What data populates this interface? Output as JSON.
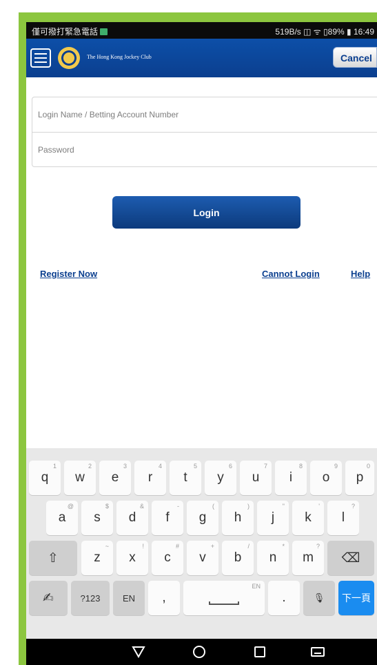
{
  "status_bar": {
    "left_text": "僅可撥打緊急電話",
    "right_text": "519B/s ◫ ᯤ ▯89% ▮ 16:49"
  },
  "header": {
    "logo_text": "The Hong Kong Jockey Club",
    "cancel_label": "Cancel"
  },
  "login_form": {
    "username_placeholder": "Login Name / Betting Account Number",
    "password_placeholder": "Password",
    "login_label": "Login"
  },
  "links": {
    "register": "Register Now",
    "cannot_login": "Cannot Login",
    "help": "Help"
  },
  "keyboard": {
    "row1": [
      {
        "label": "q",
        "hint": "1"
      },
      {
        "label": "w",
        "hint": "2"
      },
      {
        "label": "e",
        "hint": "3"
      },
      {
        "label": "r",
        "hint": "4"
      },
      {
        "label": "t",
        "hint": "5"
      },
      {
        "label": "y",
        "hint": "6"
      },
      {
        "label": "u",
        "hint": "7"
      },
      {
        "label": "i",
        "hint": "8"
      },
      {
        "label": "o",
        "hint": "9"
      },
      {
        "label": "p",
        "hint": "0"
      }
    ],
    "row2": [
      {
        "label": "a",
        "hint": "@"
      },
      {
        "label": "s",
        "hint": "$"
      },
      {
        "label": "d",
        "hint": "&"
      },
      {
        "label": "f",
        "hint": "-"
      },
      {
        "label": "g",
        "hint": "("
      },
      {
        "label": "h",
        "hint": ")"
      },
      {
        "label": "j",
        "hint": "\""
      },
      {
        "label": "k",
        "hint": "'"
      },
      {
        "label": "l",
        "hint": "?"
      }
    ],
    "row3": [
      {
        "label": "z",
        "hint": "~"
      },
      {
        "label": "x",
        "hint": "!"
      },
      {
        "label": "c",
        "hint": "#"
      },
      {
        "label": "v",
        "hint": "+"
      },
      {
        "label": "b",
        "hint": "/"
      },
      {
        "label": "n",
        "hint": "*"
      },
      {
        "label": "m",
        "hint": "?"
      }
    ],
    "shift_icon": "⇧",
    "backspace_icon": "⌫",
    "handwriting_icon": "✍",
    "symbols_label": "?123",
    "lang_label": "EN",
    "comma": ",",
    "space_hint": "EN",
    "period": ".",
    "mic_icon": "🎙",
    "next_label": "下一頁"
  },
  "nav_icons": [
    "back-icon",
    "home-icon",
    "recents-icon",
    "keyboard-switch-icon"
  ],
  "colors": {
    "frame_green": "#8cc63f",
    "header_blue": "#0b3f8f",
    "link_blue": "#0b3f8f",
    "enter_blue": "#1a8cf0"
  }
}
